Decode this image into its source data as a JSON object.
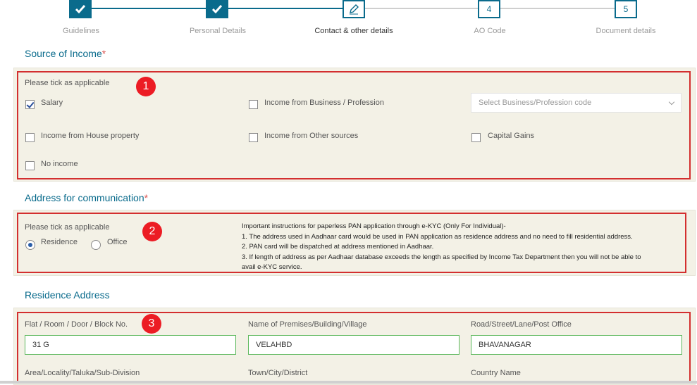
{
  "stepper": {
    "steps": [
      {
        "label": "Guidelines",
        "icon": "check-icon"
      },
      {
        "label": "Personal Details",
        "icon": "check-icon"
      },
      {
        "label": "Contact & other details",
        "icon": "pencil-icon"
      },
      {
        "label": "AO Code",
        "number": "4"
      },
      {
        "label": "Document details",
        "number": "5"
      }
    ]
  },
  "income": {
    "title": "Source of Income",
    "required_mark": "*",
    "tick_label": "Please tick as applicable",
    "badge": "1",
    "options": {
      "salary": "Salary",
      "business": "Income from Business / Profession",
      "house": "Income from House property",
      "other": "Income from Other sources",
      "capital": "Capital Gains",
      "none": "No income"
    },
    "business_select_placeholder": "Select Business/Profession code"
  },
  "address": {
    "title": "Address for communication",
    "required_mark": "*",
    "tick_label": "Please tick as applicable",
    "badge": "2",
    "residence": "Residence",
    "office": "Office",
    "instructions": [
      "Important instructions for paperless PAN application through e-KYC (Only For Individual)-",
      "1. The address used in Aadhaar card would be used in PAN application as residence address and no need to fill residential address.",
      "2. PAN card will be dispatched at address mentioned in Aadhaar.",
      "3. If length of address as per Aadhaar database exceeds the length as specified by Income Tax Department then you will not be able to",
      "avail e-KYC service."
    ]
  },
  "residence": {
    "title": "Residence Address",
    "badge": "3",
    "labels": {
      "flat": "Flat / Room / Door / Block No.",
      "premises": "Name of Premises/Building/Village",
      "road": "Road/Street/Lane/Post Office",
      "area": "Area/Locality/Taluka/Sub-Division",
      "town": "Town/City/District",
      "country": "Country Name"
    },
    "values": {
      "flat": "31 G",
      "premises": "VELAHBD",
      "road": "BHAVANAGAR"
    }
  }
}
